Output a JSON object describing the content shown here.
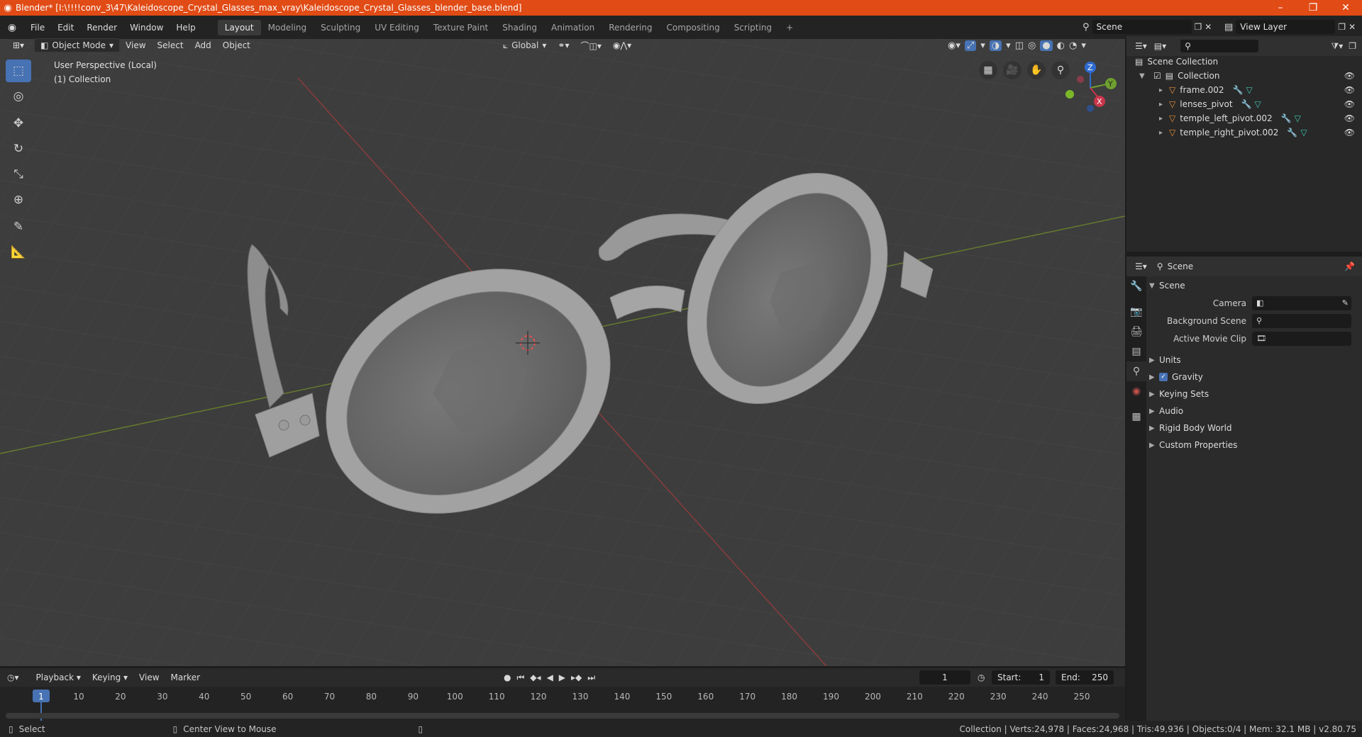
{
  "titlebar": {
    "title": "Blender* [I:\\!!!!conv_3\\47\\Kaleidoscope_Crystal_Glasses_max_vray\\Kaleidoscope_Crystal_Glasses_blender_base.blend]",
    "minimize": "–",
    "restore": "❐",
    "close": "✕"
  },
  "menu": [
    "File",
    "Edit",
    "Render",
    "Window",
    "Help"
  ],
  "workspaces": [
    "Layout",
    "Modeling",
    "Sculpting",
    "UV Editing",
    "Texture Paint",
    "Shading",
    "Animation",
    "Rendering",
    "Compositing",
    "Scripting"
  ],
  "active_workspace": "Layout",
  "add_workspace": "+",
  "scene_field": "Scene",
  "viewlayer_field": "View Layer",
  "viewport_header": {
    "mode": "Object Mode",
    "menus": [
      "View",
      "Select",
      "Add",
      "Object"
    ],
    "transform": "Global"
  },
  "viewport": {
    "perspective": "User Perspective (Local)",
    "collection": "(1) Collection",
    "gizmo": {
      "x": "X",
      "y": "Y",
      "z": "Z"
    }
  },
  "outliner": {
    "root": "Scene Collection",
    "collection": "Collection",
    "items": [
      "frame.002",
      "lenses_pivot",
      "temple_left_pivot.002",
      "temple_right_pivot.002"
    ]
  },
  "properties": {
    "header": "Scene",
    "section": "Scene",
    "fields": [
      {
        "label": "Camera",
        "value": ""
      },
      {
        "label": "Background Scene",
        "value": ""
      },
      {
        "label": "Active Movie Clip",
        "value": ""
      }
    ],
    "sections": [
      "Units",
      "Gravity",
      "Keying Sets",
      "Audio",
      "Rigid Body World",
      "Custom Properties"
    ],
    "gravity_checked": true
  },
  "timeline": {
    "menus": [
      "Playback",
      "Keying",
      "View",
      "Marker"
    ],
    "current_frame": "1",
    "start_label": "Start:",
    "start": "1",
    "end_label": "End:",
    "end": "250",
    "ticks": [
      "1",
      "10",
      "20",
      "30",
      "40",
      "50",
      "60",
      "70",
      "80",
      "90",
      "100",
      "110",
      "120",
      "130",
      "140",
      "150",
      "160",
      "170",
      "180",
      "190",
      "200",
      "210",
      "220",
      "230",
      "240",
      "250"
    ]
  },
  "statusbar": {
    "select": "Select",
    "center": "Center View to Mouse",
    "stats": "Collection | Verts:24,978 | Faces:24,968 | Tris:49,936 | Objects:0/4 | Mem: 32.1 MB | v2.80.75"
  },
  "colors": {
    "accent": "#4772b3",
    "title": "#e14b15",
    "object_icon": "#e8913c",
    "mesh_icon": "#3fc9b1"
  }
}
